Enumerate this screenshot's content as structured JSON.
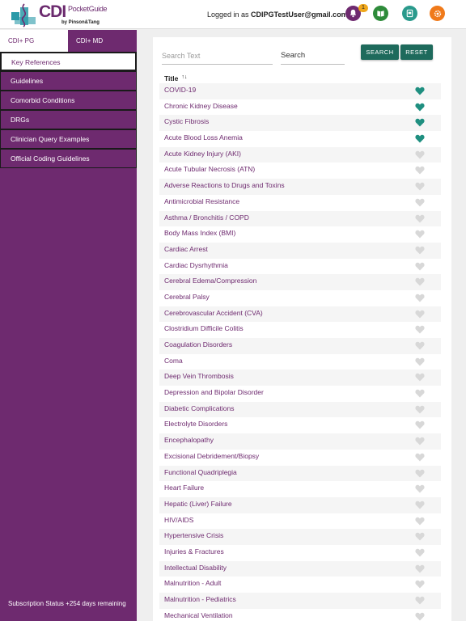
{
  "header": {
    "logo": {
      "brand": "CDI",
      "product": "PocketGuide",
      "by": "by Pinson&Tang"
    },
    "logged_in_prefix": "Logged in as ",
    "user_email": "CDIPGTestUser@gmail.com",
    "notification_count": "1",
    "icons": [
      "bell-icon",
      "book-icon",
      "tablet-icon",
      "gear-icon"
    ],
    "icon_colors": {
      "bell": "#6e2a6f",
      "book": "#2e8b3a",
      "tablet": "#2a9a8c",
      "gear": "#f07a1a"
    }
  },
  "sidebar": {
    "tabs": [
      {
        "label": "CDI+ PG",
        "active": true
      },
      {
        "label": "CDI+ MD",
        "active": false
      }
    ],
    "items": [
      {
        "label": "Key References",
        "active": true
      },
      {
        "label": "Guidelines",
        "active": false
      },
      {
        "label": "Comorbid Conditions",
        "active": false
      },
      {
        "label": "DRGs",
        "active": false
      },
      {
        "label": "Clinician Query Examples",
        "active": false
      },
      {
        "label": "Official Coding Guidelines",
        "active": false
      }
    ],
    "subscription": "Subscription Status +254 days remaining"
  },
  "main": {
    "search_placeholder": "Search Text",
    "search_value": "",
    "search_type": "Search",
    "search_button": "SEARCH",
    "reset_button": "RESET",
    "column_header": "Title",
    "sort_symbol": "↑↓",
    "favorite_color": "#1f8f80",
    "unfavorite_color": "#d8d8d8",
    "rows": [
      {
        "title": "COVID-19",
        "favorite": true
      },
      {
        "title": "Chronic Kidney Disease",
        "favorite": true
      },
      {
        "title": "Cystic Fibrosis",
        "favorite": true
      },
      {
        "title": "Acute Blood Loss Anemia",
        "favorite": true
      },
      {
        "title": "Acute Kidney Injury (AKI)",
        "favorite": false
      },
      {
        "title": "Acute Tubular Necrosis (ATN)",
        "favorite": false
      },
      {
        "title": "Adverse Reactions to Drugs and Toxins",
        "favorite": false
      },
      {
        "title": "Antimicrobial Resistance",
        "favorite": false
      },
      {
        "title": "Asthma / Bronchitis / COPD",
        "favorite": false
      },
      {
        "title": "Body Mass Index (BMI)",
        "favorite": false
      },
      {
        "title": "Cardiac Arrest",
        "favorite": false
      },
      {
        "title": "Cardiac Dysrhythmia",
        "favorite": false
      },
      {
        "title": "Cerebral Edema/Compression",
        "favorite": false
      },
      {
        "title": "Cerebral Palsy",
        "favorite": false
      },
      {
        "title": "Cerebrovascular Accident (CVA)",
        "favorite": false
      },
      {
        "title": "Clostridium Difficile Colitis",
        "favorite": false
      },
      {
        "title": "Coagulation Disorders",
        "favorite": false
      },
      {
        "title": "Coma",
        "favorite": false
      },
      {
        "title": "Deep Vein Thrombosis",
        "favorite": false
      },
      {
        "title": "Depression and Bipolar Disorder",
        "favorite": false
      },
      {
        "title": "Diabetic Complications",
        "favorite": false
      },
      {
        "title": "Electrolyte Disorders",
        "favorite": false
      },
      {
        "title": "Encephalopathy",
        "favorite": false
      },
      {
        "title": "Excisional Debridement/Biopsy",
        "favorite": false
      },
      {
        "title": "Functional Quadriplegia",
        "favorite": false
      },
      {
        "title": "Heart Failure",
        "favorite": false
      },
      {
        "title": "Hepatic (Liver) Failure",
        "favorite": false
      },
      {
        "title": "HIV/AIDS",
        "favorite": false
      },
      {
        "title": "Hypertensive Crisis",
        "favorite": false
      },
      {
        "title": "Injuries & Fractures",
        "favorite": false
      },
      {
        "title": "Intellectual Disability",
        "favorite": false
      },
      {
        "title": "Malnutrition - Adult",
        "favorite": false
      },
      {
        "title": "Malnutrition - Pediatrics",
        "favorite": false
      },
      {
        "title": "Mechanical Ventilation",
        "favorite": false
      }
    ]
  }
}
